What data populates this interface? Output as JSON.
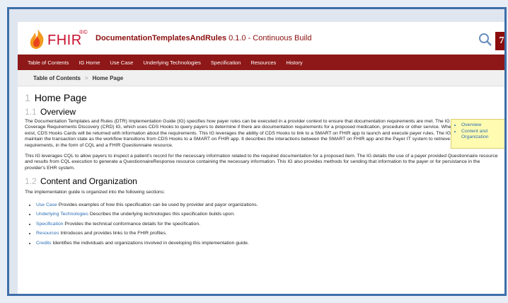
{
  "header": {
    "logo_text": "FHIR",
    "logo_reg": "®©",
    "ig_name": "DocumentationTemplatesAndRules",
    "ig_version": "0.1.0 - Continuous Build",
    "hl7_text": "7"
  },
  "nav": {
    "items": [
      "Table of Contents",
      "IG Home",
      "Use Case",
      "Underlying Technologies",
      "Specification",
      "Resources",
      "History"
    ]
  },
  "breadcrumb": {
    "root": "Table of Contents",
    "sep": ">",
    "current": "Home Page"
  },
  "page": {
    "h1_num": "1",
    "h1": "Home Page",
    "s1_num": "1.1",
    "s1": "Overview",
    "p1": "The Documentation Templates and Rules (DTR) Implementation Guide (IG) specifies how payer rules can be executed in a provider context to ensure that documentation requirements are met. The IG is a companion to the Coverage Requirements Discovery (CRD) IG, which uses CDS Hooks to query payers to determine if there are documentation requirements for a proposed medication, procedure or other service. When those requirements exist, CDS Hooks Cards will be returned with information about the requirements. This IG leverages the ability of CDS Hooks to link to a SMART on FHIR app to launch and execute payer rules. The IG specifies how to maintain the transaction state as the workflow transitions from CDS Hooks to a SMART on FHIR app. It describes the interactions between the SMART on FHIR app and the Payer IT system to retrieve documentation requirements, in the form of CQL and a FHIR Questionnaire resource.",
    "p2": "This IG leverages CQL to allow payers to inspect a patient's record for the necessary information related to the required documentation for a proposed item. The IG details the use of a payer provided Questionnaire resource and results from CQL execution to generate a QuestionnaireResponse resource containing the necessary information. This IG also provides methods for sending that information to the payer or for persistance in the provider's EHR system.",
    "s2_num": "1.2",
    "s2": "Content and Organization",
    "p3": "The implementation guide is organized into the following sections:",
    "sections": [
      {
        "link": "Use Case",
        "text": " Provides examples of how this specification can be used by provider and payor organizations."
      },
      {
        "link": "Underlying Technologies",
        "text": " Describes the underlying technologies this specification builds upon."
      },
      {
        "link": "Specification",
        "text": " Provides the technical conformance details for the specification."
      },
      {
        "link": "Resources",
        "text": " Introduces and provides links to the FHIR profiles."
      },
      {
        "link": "Credits",
        "text": " Identifies the individuals and organizations involved in developing this implementation guide."
      }
    ]
  },
  "toc": {
    "items": [
      "Overview",
      "Content and Organization"
    ]
  },
  "colors": {
    "nav_bg": "#8e1717",
    "link": "#2a6db3",
    "toc_bg": "#fffbb0"
  }
}
